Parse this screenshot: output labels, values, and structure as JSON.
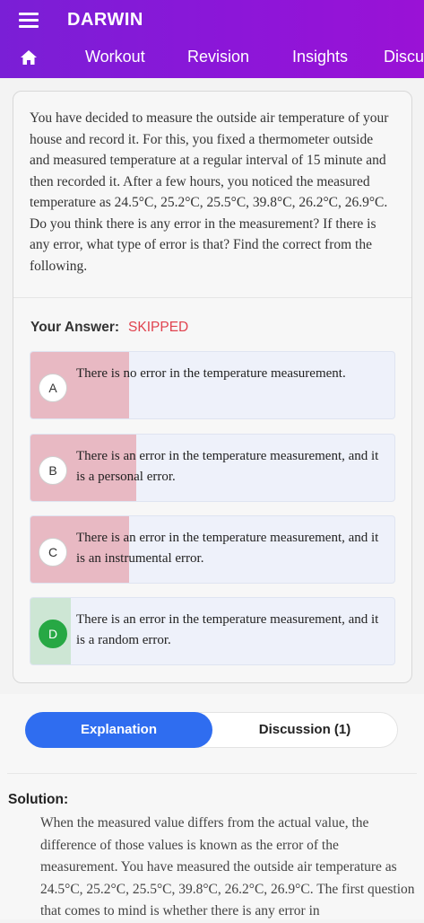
{
  "header": {
    "title": "DARWIN",
    "nav": [
      "Workout",
      "Revision",
      "Insights",
      "Discu"
    ]
  },
  "question": {
    "text": "You have decided to measure the outside air temperature of your house and record it. For this, you fixed a thermometer outside and measured temperature at a regular interval of 15 minute and then recorded it. After a few hours, you noticed the measured temperature as 24.5°C, 25.2°C, 25.5°C, 39.8°C, 26.2°C, 26.9°C. Do you think there is any error in the measurement? If there is any error, what type of error is that? Find the correct from the following."
  },
  "answer": {
    "label": "Your Answer:",
    "value": "SKIPPED"
  },
  "options": [
    {
      "letter": "A",
      "text": "There is no error in the temperature measurement.",
      "percent": 27,
      "correct": false
    },
    {
      "letter": "B",
      "text": "There is an error in the temperature measurement, and it is a personal error.",
      "percent": 29,
      "correct": false
    },
    {
      "letter": "C",
      "text": "There is an error in the temperature measurement, and it is an instrumental error.",
      "percent": 27,
      "correct": false
    },
    {
      "letter": "D",
      "text": "There is an error in the temperature measurement, and it is a random error.",
      "percent": 11,
      "correct": true
    }
  ],
  "tabs": {
    "explanation": "Explanation",
    "discussion": "Discussion (1)"
  },
  "solution": {
    "title": "Solution:",
    "text": "When the measured value differs from the actual value, the difference of those values is known as the error of the measurement. You have measured the outside air temperature as 24.5°C, 25.2°C, 25.5°C, 39.8°C, 26.2°C, 26.9°C. The first question that comes to mind is whether there is any error in"
  },
  "colors": {
    "header": "#8c16d8",
    "accent": "#2f6df0",
    "skipped": "#e0434f",
    "wrong_fill": "#e8b9c3",
    "correct_fill": "#cde6d4",
    "correct_badge": "#27a844"
  }
}
